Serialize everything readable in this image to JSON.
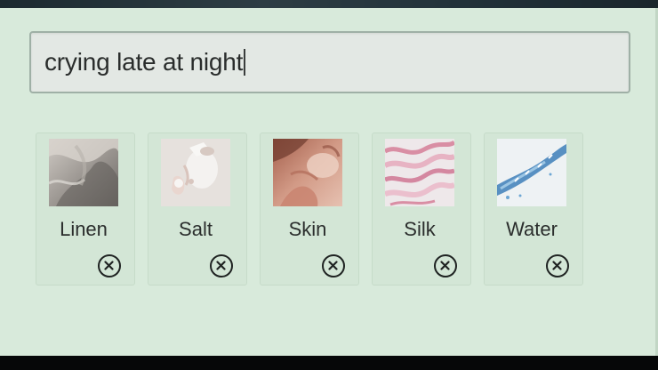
{
  "search": {
    "value": "crying late at night"
  },
  "tags": [
    {
      "label": "Linen",
      "image": "linen-fabric-image",
      "icon": "close-circle-icon"
    },
    {
      "label": "Salt",
      "image": "salt-image",
      "icon": "close-circle-icon"
    },
    {
      "label": "Skin",
      "image": "skin-image",
      "icon": "close-circle-icon"
    },
    {
      "label": "Silk",
      "image": "silk-image",
      "icon": "close-circle-icon"
    },
    {
      "label": "Water",
      "image": "water-image",
      "icon": "close-circle-icon"
    }
  ],
  "colors": {
    "panel_background": "#d8eadb",
    "input_background": "#e3e8e4",
    "input_border": "#9fb0a6",
    "text": "#2b2e2d",
    "frame": "#050607"
  }
}
